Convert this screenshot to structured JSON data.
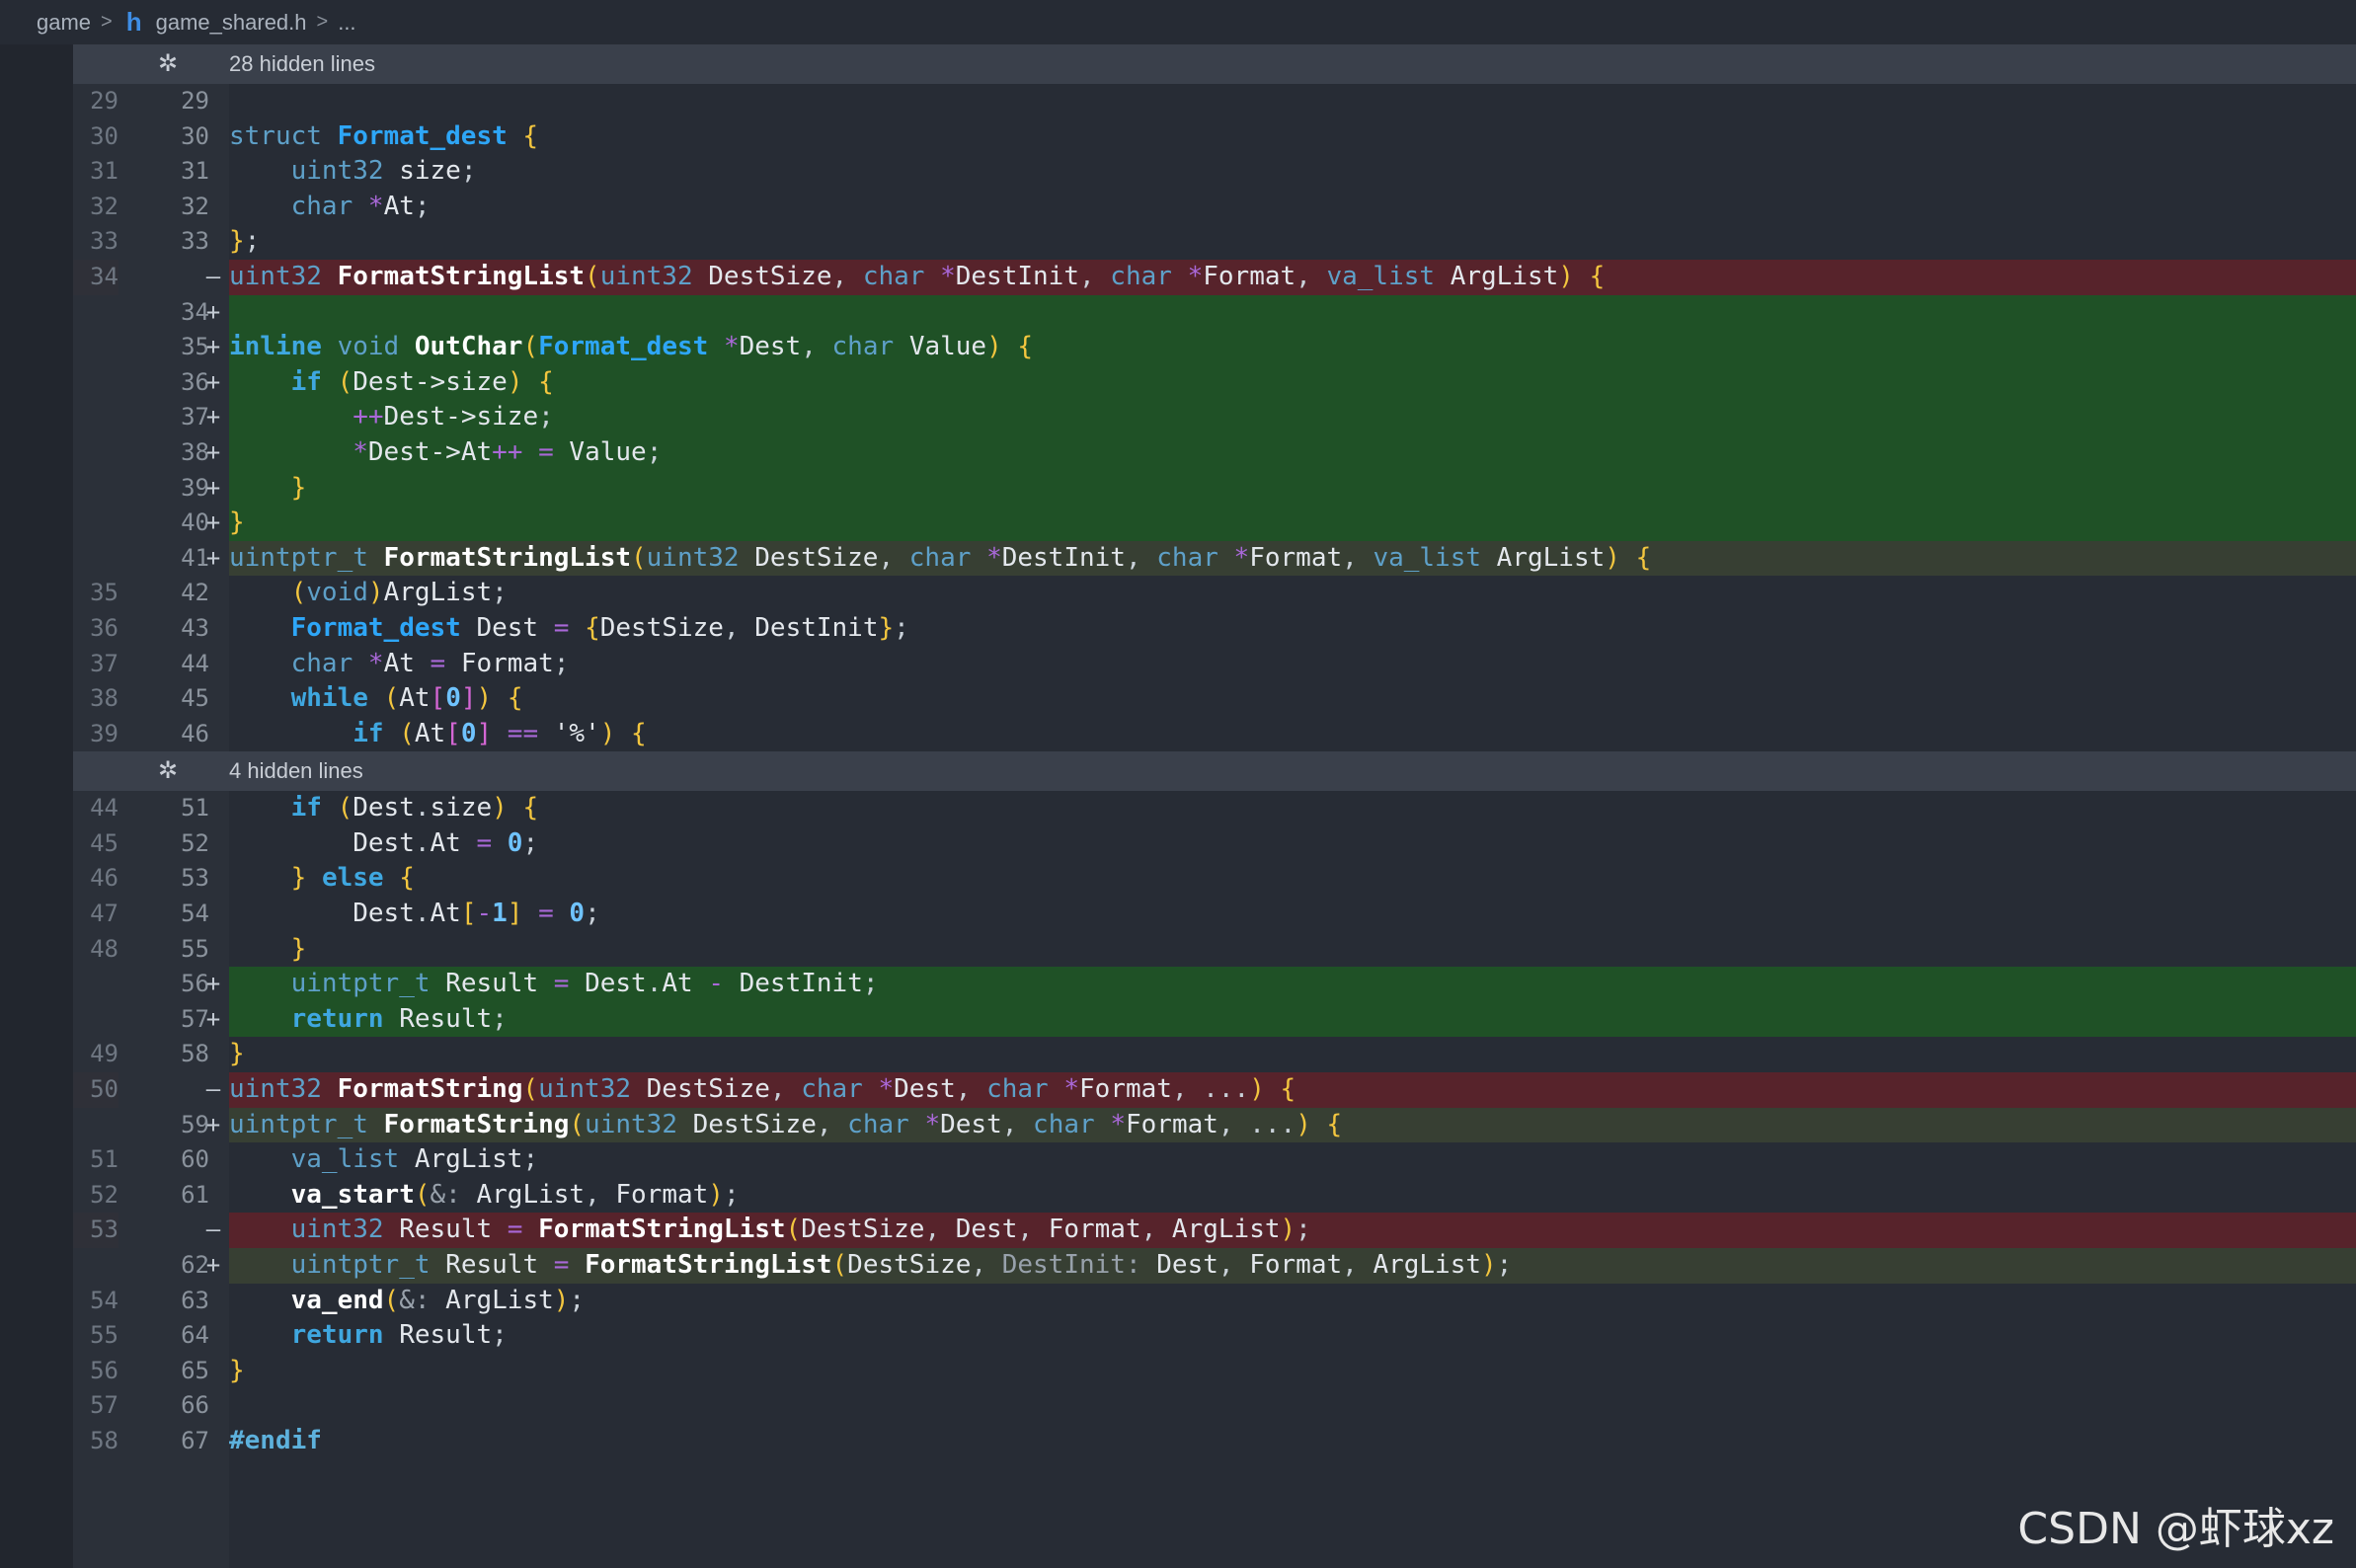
{
  "breadcrumb": {
    "folder": "game",
    "sep": ">",
    "file": "game_shared.h",
    "more": "..."
  },
  "hidden_regions": [
    {
      "icon": "unfold-icon",
      "label": "28 hidden lines"
    },
    {
      "icon": "unfold-icon",
      "label": "4 hidden lines"
    }
  ],
  "watermark": "CSDN @虾球xz",
  "colors": {
    "deleted": "#57232b",
    "added": "#1f5126",
    "modified": "#373f33",
    "background": "#272c35"
  },
  "lines": [
    {
      "ln1": "29",
      "ln2": "29",
      "mk": "",
      "kind": "",
      "text": ""
    },
    {
      "ln1": "30",
      "ln2": "30",
      "mk": "",
      "kind": "",
      "text": "struct Format_dest {"
    },
    {
      "ln1": "31",
      "ln2": "31",
      "mk": "",
      "kind": "",
      "text": "    uint32 size;"
    },
    {
      "ln1": "32",
      "ln2": "32",
      "mk": "",
      "kind": "",
      "text": "    char *At;"
    },
    {
      "ln1": "33",
      "ln2": "33",
      "mk": "",
      "kind": "",
      "text": "};"
    },
    {
      "ln1": "34",
      "ln2": "",
      "mk": "—",
      "kind": "del",
      "text": "uint32 FormatStringList(uint32 DestSize, char *DestInit, char *Format, va_list ArgList) {"
    },
    {
      "ln1": "",
      "ln2": "34",
      "mk": "+",
      "kind": "add",
      "text": ""
    },
    {
      "ln1": "",
      "ln2": "35",
      "mk": "+",
      "kind": "add",
      "text": "inline void OutChar(Format_dest *Dest, char Value) {"
    },
    {
      "ln1": "",
      "ln2": "36",
      "mk": "+",
      "kind": "add",
      "text": "    if (Dest->size) {"
    },
    {
      "ln1": "",
      "ln2": "37",
      "mk": "+",
      "kind": "add",
      "text": "        ++Dest->size;"
    },
    {
      "ln1": "",
      "ln2": "38",
      "mk": "+",
      "kind": "add",
      "text": "        *Dest->At++ = Value;"
    },
    {
      "ln1": "",
      "ln2": "39",
      "mk": "+",
      "kind": "add",
      "text": "    }"
    },
    {
      "ln1": "",
      "ln2": "40",
      "mk": "+",
      "kind": "add",
      "text": "}"
    },
    {
      "ln1": "",
      "ln2": "41",
      "mk": "+",
      "kind": "mod",
      "text": "uintptr_t FormatStringList(uint32 DestSize, char *DestInit, char *Format, va_list ArgList) {"
    },
    {
      "ln1": "35",
      "ln2": "42",
      "mk": "",
      "kind": "",
      "text": "    (void)ArgList;"
    },
    {
      "ln1": "36",
      "ln2": "43",
      "mk": "",
      "kind": "",
      "text": "    Format_dest Dest = {DestSize, DestInit};"
    },
    {
      "ln1": "37",
      "ln2": "44",
      "mk": "",
      "kind": "",
      "text": "    char *At = Format;"
    },
    {
      "ln1": "38",
      "ln2": "45",
      "mk": "",
      "kind": "",
      "text": "    while (At[0]) {"
    },
    {
      "ln1": "39",
      "ln2": "46",
      "mk": "",
      "kind": "",
      "text": "        if (At[0] == '%') {"
    },
    {
      "hidden": 1
    },
    {
      "ln1": "44",
      "ln2": "51",
      "mk": "",
      "kind": "",
      "text": "    if (Dest.size) {"
    },
    {
      "ln1": "45",
      "ln2": "52",
      "mk": "",
      "kind": "",
      "text": "        Dest.At = 0;"
    },
    {
      "ln1": "46",
      "ln2": "53",
      "mk": "",
      "kind": "",
      "text": "    } else {"
    },
    {
      "ln1": "47",
      "ln2": "54",
      "mk": "",
      "kind": "",
      "text": "        Dest.At[-1] = 0;"
    },
    {
      "ln1": "48",
      "ln2": "55",
      "mk": "",
      "kind": "",
      "text": "    }"
    },
    {
      "ln1": "",
      "ln2": "56",
      "mk": "+",
      "kind": "add",
      "text": "    uintptr_t Result = Dest.At - DestInit;"
    },
    {
      "ln1": "",
      "ln2": "57",
      "mk": "+",
      "kind": "add",
      "text": "    return Result;"
    },
    {
      "ln1": "49",
      "ln2": "58",
      "mk": "",
      "kind": "",
      "text": "}"
    },
    {
      "ln1": "50",
      "ln2": "",
      "mk": "—",
      "kind": "del",
      "text": "uint32 FormatString(uint32 DestSize, char *Dest, char *Format, ...) {"
    },
    {
      "ln1": "",
      "ln2": "59",
      "mk": "+",
      "kind": "mod",
      "text": "uintptr_t FormatString(uint32 DestSize, char *Dest, char *Format, ...) {"
    },
    {
      "ln1": "51",
      "ln2": "60",
      "mk": "",
      "kind": "",
      "text": "    va_list ArgList;"
    },
    {
      "ln1": "52",
      "ln2": "61",
      "mk": "",
      "kind": "",
      "text": "    va_start(&: ArgList, Format);"
    },
    {
      "ln1": "53",
      "ln2": "",
      "mk": "—",
      "kind": "del",
      "text": "    uint32 Result = FormatStringList(DestSize, Dest, Format, ArgList);"
    },
    {
      "ln1": "",
      "ln2": "62",
      "mk": "+",
      "kind": "mod",
      "text": "    uintptr_t Result = FormatStringList(DestSize, DestInit: Dest, Format, ArgList);"
    },
    {
      "ln1": "54",
      "ln2": "63",
      "mk": "",
      "kind": "",
      "text": "    va_end(&: ArgList);"
    },
    {
      "ln1": "55",
      "ln2": "64",
      "mk": "",
      "kind": "",
      "text": "    return Result;"
    },
    {
      "ln1": "56",
      "ln2": "65",
      "mk": "",
      "kind": "",
      "text": "}"
    },
    {
      "ln1": "57",
      "ln2": "66",
      "mk": "",
      "kind": "",
      "text": ""
    },
    {
      "ln1": "58",
      "ln2": "67",
      "mk": "",
      "kind": "",
      "text": "#endif"
    }
  ]
}
